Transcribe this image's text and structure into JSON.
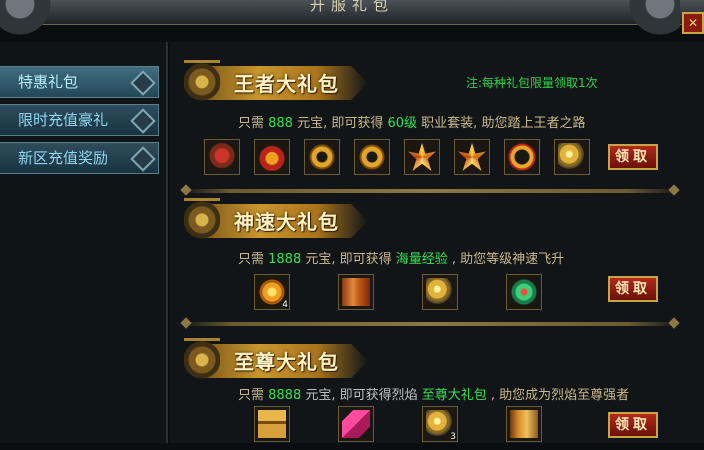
{
  "window": {
    "title": "开服礼包",
    "close_symbol": "✕"
  },
  "sidebar": {
    "tabs": [
      {
        "label": "特惠礼包",
        "active": true
      },
      {
        "label": "限时充值豪礼",
        "active": false
      },
      {
        "label": "新区充值奖励",
        "active": false
      }
    ]
  },
  "note": "注:每种礼包限量领取1次",
  "packs": [
    {
      "title": "王者大礼包",
      "desc_prefix": "只需 ",
      "price": "888",
      "desc_mid": " 元宝, 即可获得 ",
      "reward_name": "60级",
      "desc_suffix": " 职业套装, 助您踏上王者之路",
      "claim_label": "领取",
      "items": [
        {
          "icon": "armor-icon",
          "count": ""
        },
        {
          "icon": "helmet-icon",
          "count": ""
        },
        {
          "icon": "bracelet-icon",
          "count": ""
        },
        {
          "icon": "bracelet-icon",
          "count": ""
        },
        {
          "icon": "ring-icon",
          "count": ""
        },
        {
          "icon": "ring-icon",
          "count": ""
        },
        {
          "icon": "necklace-icon",
          "count": ""
        },
        {
          "icon": "gold-orb-icon",
          "count": ""
        }
      ]
    },
    {
      "title": "神速大礼包",
      "desc_prefix": "只需 ",
      "price": "1888",
      "desc_mid": " 元宝, 即可获得 ",
      "reward_name": "海量经验",
      "desc_suffix": " , 助您等级神速飞升",
      "claim_label": "领取",
      "items": [
        {
          "icon": "exp-gem-icon",
          "count": "4"
        },
        {
          "icon": "scroll-icon",
          "count": ""
        },
        {
          "icon": "gold-orb-icon",
          "count": ""
        },
        {
          "icon": "jade-flower-icon",
          "count": ""
        }
      ]
    },
    {
      "title": "至尊大礼包",
      "desc_prefix": "只需 ",
      "price": "8888",
      "desc_mid": " 元宝, 即可获得烈焰 ",
      "reward_name": "至尊大礼包",
      "desc_suffix": " , 助您成为烈焰至尊强者",
      "claim_label": "领取",
      "items": [
        {
          "icon": "treasure-chest-icon",
          "count": ""
        },
        {
          "icon": "crystal-icon",
          "count": ""
        },
        {
          "icon": "gold-orb-icon",
          "count": "3"
        },
        {
          "icon": "book-icon",
          "count": ""
        }
      ]
    }
  ],
  "colors": {
    "price": "#35e052",
    "note": "#2fd54a",
    "tab_text": "#8fd5f0",
    "claim_bg": "#8a1b10"
  }
}
